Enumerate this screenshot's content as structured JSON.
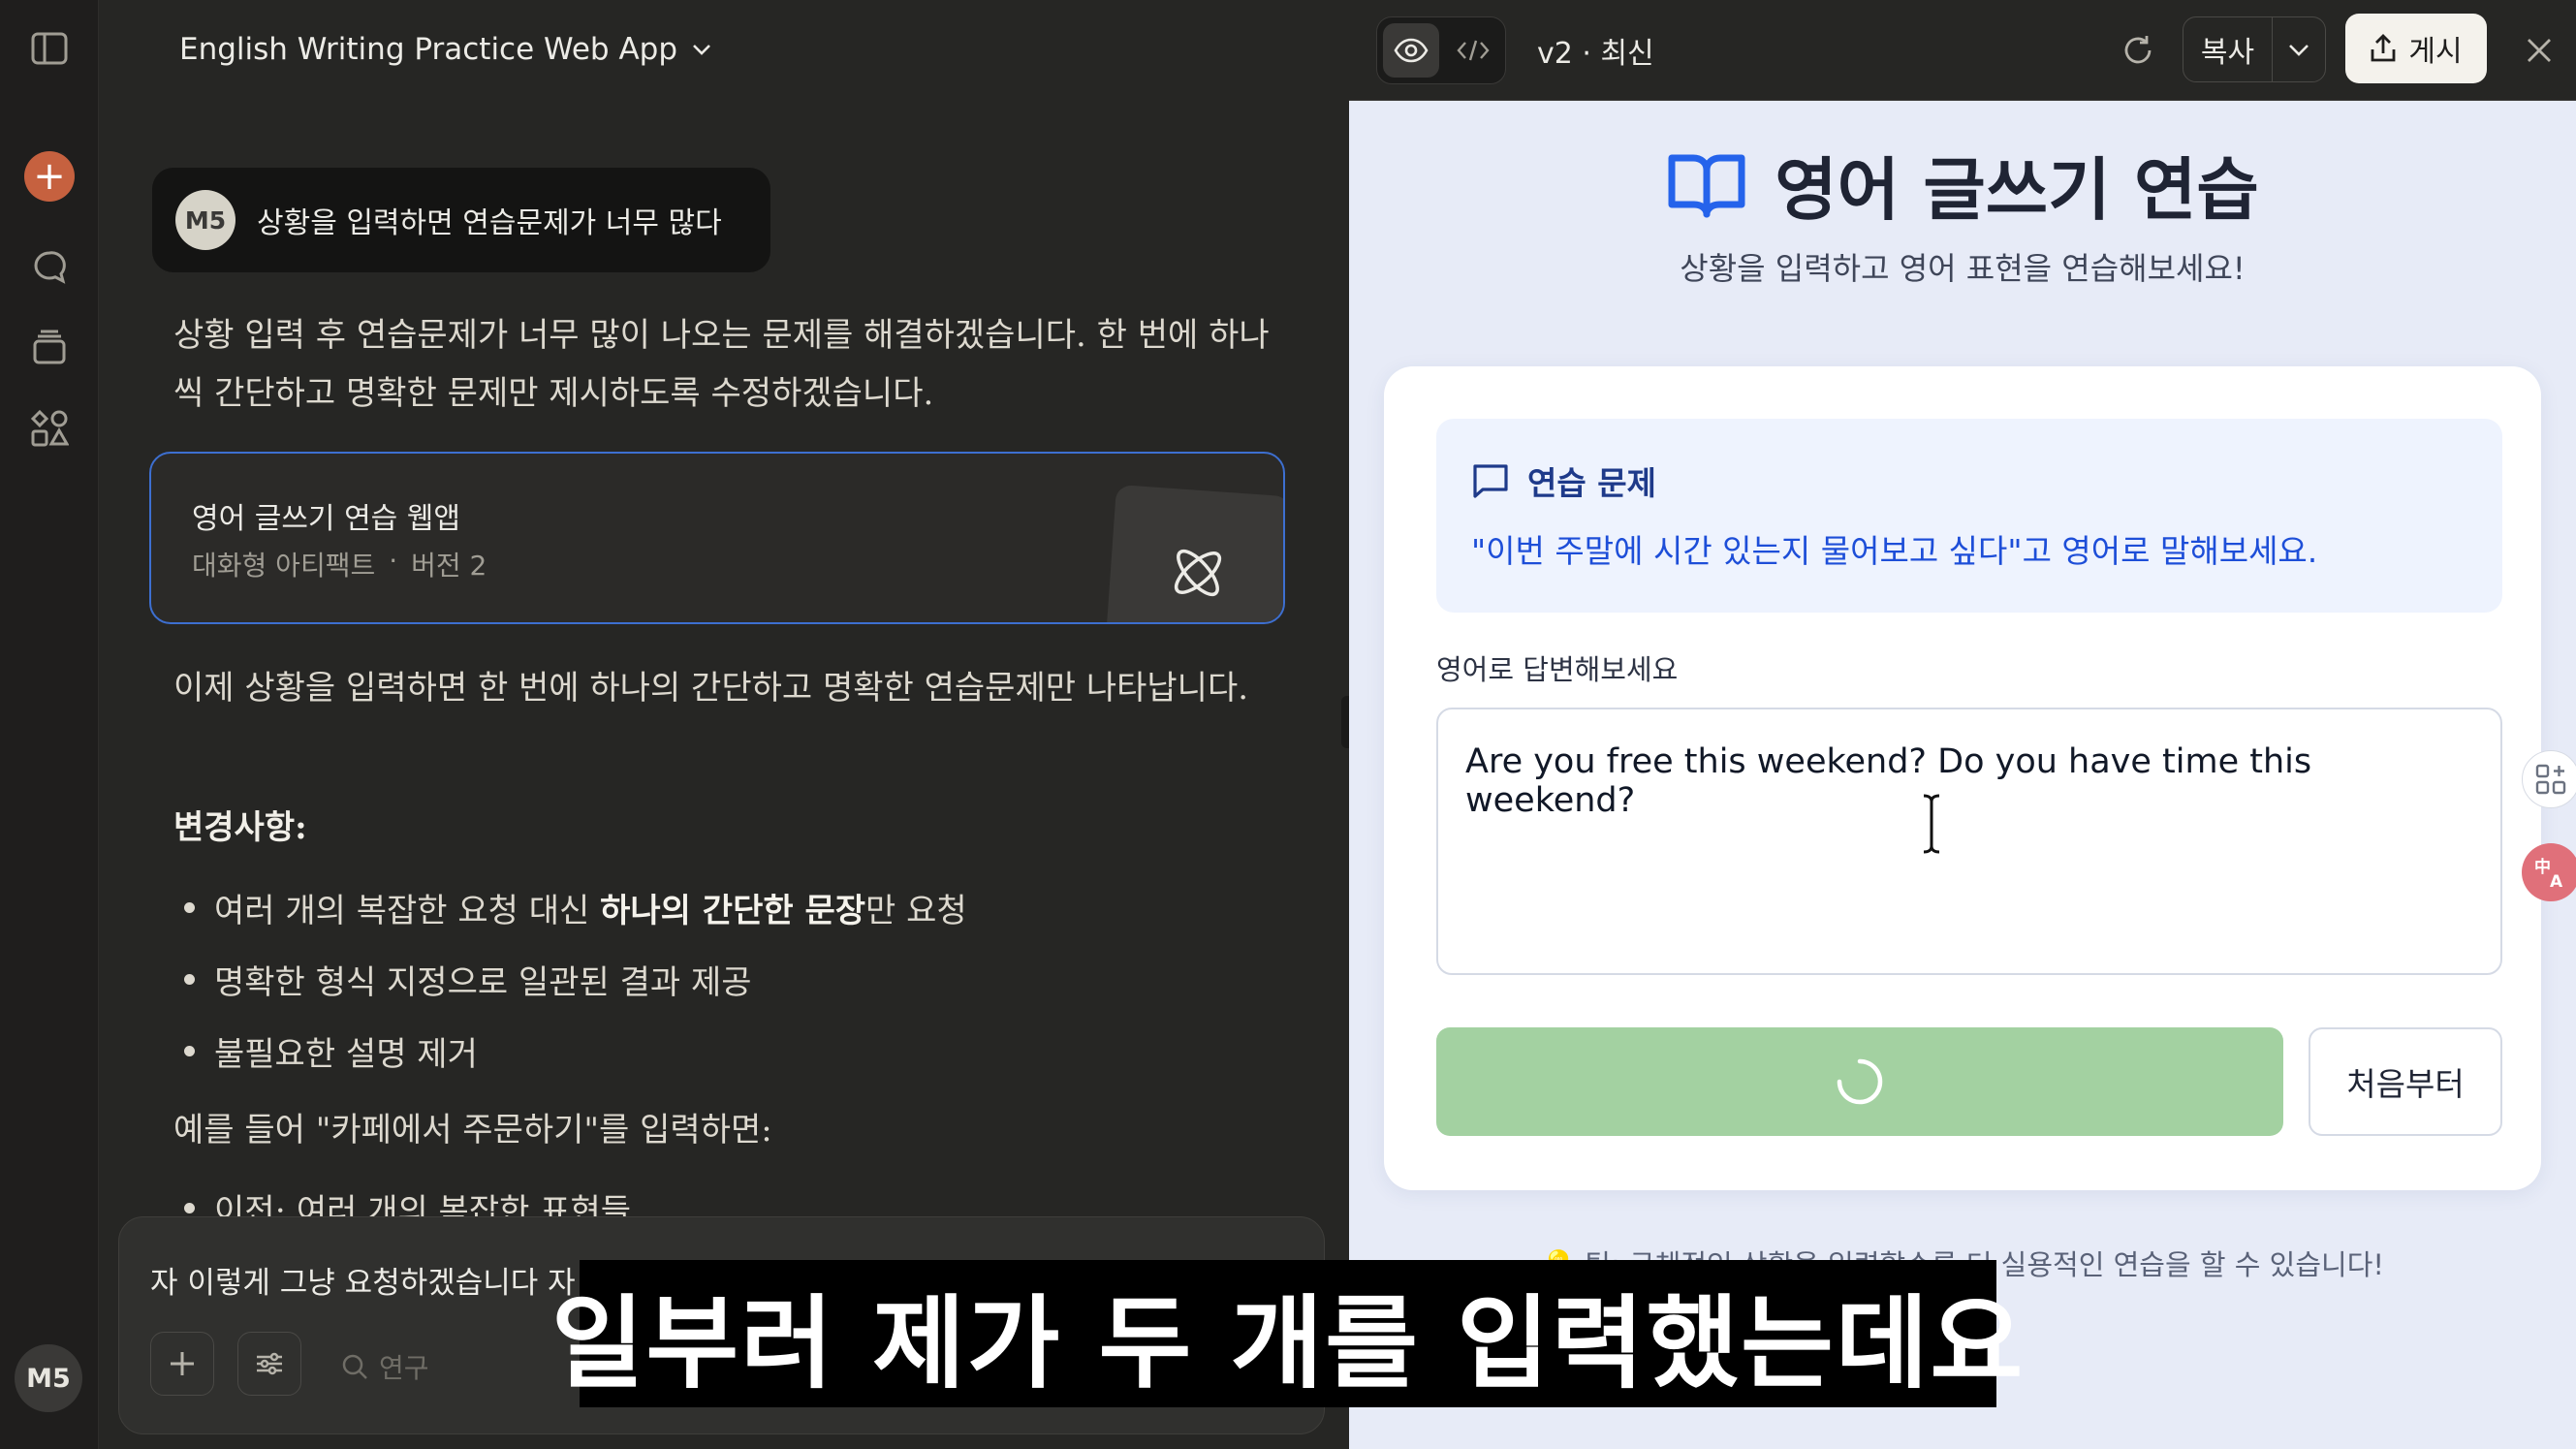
{
  "chat": {
    "title": "English Writing Practice Web App",
    "user_avatar": "M5",
    "user_message": "상황을 입력하면 연습문제가 너무 많다",
    "reply_1": "상황 입력 후 연습문제가 너무 많이 나오는 문제를 해결하겠습니다. 한 번에 하나씩 간단하고 명확한 문제만 제시하도록 수정하겠습니다.",
    "artifact": {
      "title": "영어 글쓰기 연습 웹앱",
      "type": "대화형 아티팩트",
      "separator": "·",
      "version": "버전 2"
    },
    "reply_2": "이제 상황을 입력하면 한 번에 하나의 간단하고 명확한 연습문제만 나타납니다.",
    "changes_heading": "변경사항:",
    "bullets": {
      "b1_pre": "여러 개의 복잡한 요청 대신 ",
      "b1_strong": "하나의 간단한 문장",
      "b1_post": "만 요청",
      "b2": "명확한 형식 지정으로 일관된 결과 제공",
      "b3": "불필요한 설명 제거"
    },
    "example_line": "예를 들어 \"카페에서 주문하기\"를 입력하면:",
    "cut_bullet": "이전: 여러 개의 복잡한 표현들",
    "composer_text": "자 이렇게 그냥 요청하겠습니다 자",
    "research_label": "연구"
  },
  "rail": {
    "avatar": "M5",
    "icons": [
      "sidebar-toggle-icon",
      "new-chat-plus-icon",
      "chats-search-icon",
      "projects-icon",
      "artifacts-icon"
    ]
  },
  "preview_bar": {
    "version": "v2 · 최신",
    "copy": "복사",
    "publish": "게시"
  },
  "app": {
    "title": "영어 글쓰기 연습",
    "subtitle": "상황을 입력하고 영어 표현을 연습해보세요!",
    "prompt_heading": "연습 문제",
    "prompt_text": "\"이번 주말에 시간 있는지 물어보고 싶다\"고 영어로 말해보세요.",
    "answer_label": "영어로 답변해보세요",
    "answer_value": "Are you free this weekend? Do you have time this weekend?",
    "restart": "처음부터",
    "tip": "💡 팁: 구체적인 상황을 입력할수록 더 실용적인 연습을 할 수 있습니다!"
  },
  "overlay_subtitle": "일부러 제가 두 개를 입력했는데요",
  "colors": {
    "accent": "#c6613f",
    "artifact_border": "#3d6fd0",
    "submit_loading": "#a3d1a1",
    "prompt_text": "#1d4ed8"
  }
}
